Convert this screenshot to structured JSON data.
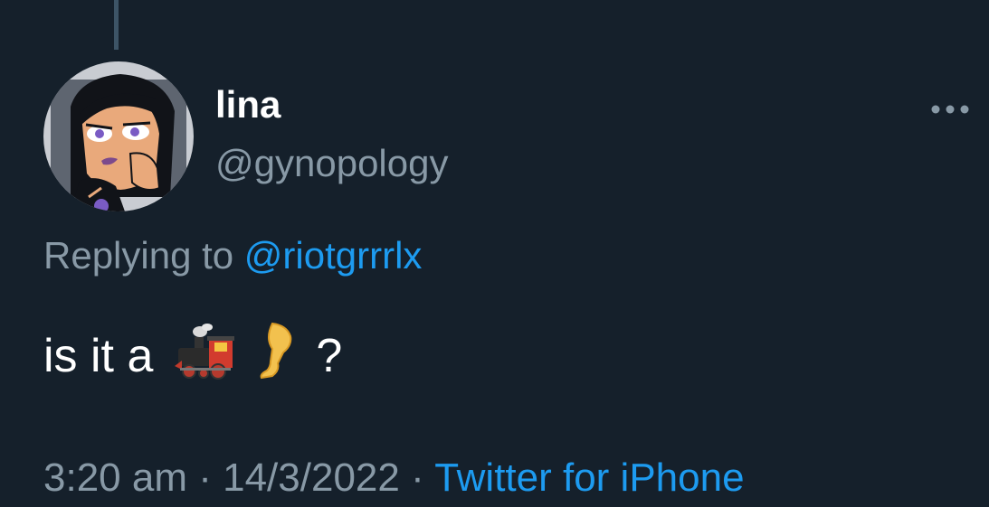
{
  "user": {
    "display_name": "lina",
    "handle": "@gynopology",
    "avatar_icon": "cartoon-avatar"
  },
  "reply": {
    "prefix": "Replying to",
    "mention": "@riotgrrrlx"
  },
  "tweet": {
    "text_before": "is it a",
    "emojis": [
      "locomotive-emoji",
      "leg-emoji"
    ],
    "text_after": "?"
  },
  "meta": {
    "time": "3:20 am",
    "separator": "·",
    "date": "14/3/2022",
    "source": "Twitter for iPhone"
  },
  "colors": {
    "background": "#15202b",
    "secondary_text": "#8899a6",
    "link": "#1d9bf0"
  }
}
